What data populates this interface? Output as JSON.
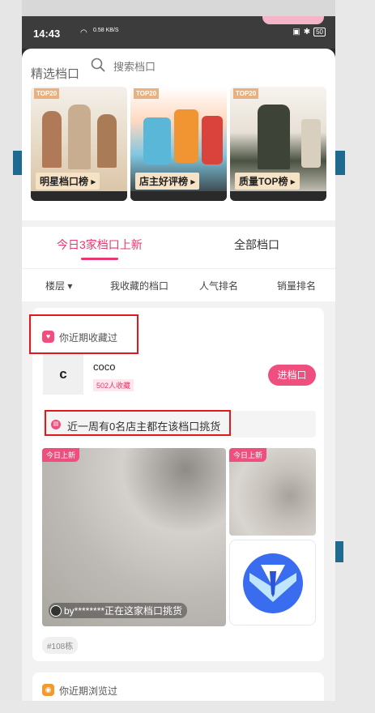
{
  "statusbar": {
    "time": "14:43",
    "network_speed": "0.58 KB/S",
    "battery": "50"
  },
  "header": {
    "section_title": "精选档口",
    "search_placeholder": "搜索档口"
  },
  "rankings": [
    {
      "badge": "TOP20",
      "label": "明星档口榜 ▸"
    },
    {
      "badge": "TOP20",
      "label": "店主好评榜 ▸"
    },
    {
      "badge": "TOP20",
      "label": "质量TOP榜 ▸"
    }
  ],
  "tabs": {
    "today_new": "今日3家档口上新",
    "all": "全部档口"
  },
  "filters": {
    "floor": "楼层 ▾",
    "my_favorites": "我收藏的档口",
    "popularity": "人气排名",
    "sales": "销量排名"
  },
  "favorites": {
    "title": "你近期收藏过",
    "shop_initial": "c",
    "shop_name": "coco",
    "fav_count": "502人收藏",
    "enter_button": "进档口",
    "week_text": "近一周有0名店主都在该档口挑货",
    "new_badge": "今日上新",
    "picker_text": "by********正在这家档口挑货",
    "block_tag": "#108栋"
  },
  "recent": {
    "title": "你近期浏览过"
  },
  "colors": {
    "accent": "#ee4f7f",
    "highlight_box": "#e0191f"
  }
}
